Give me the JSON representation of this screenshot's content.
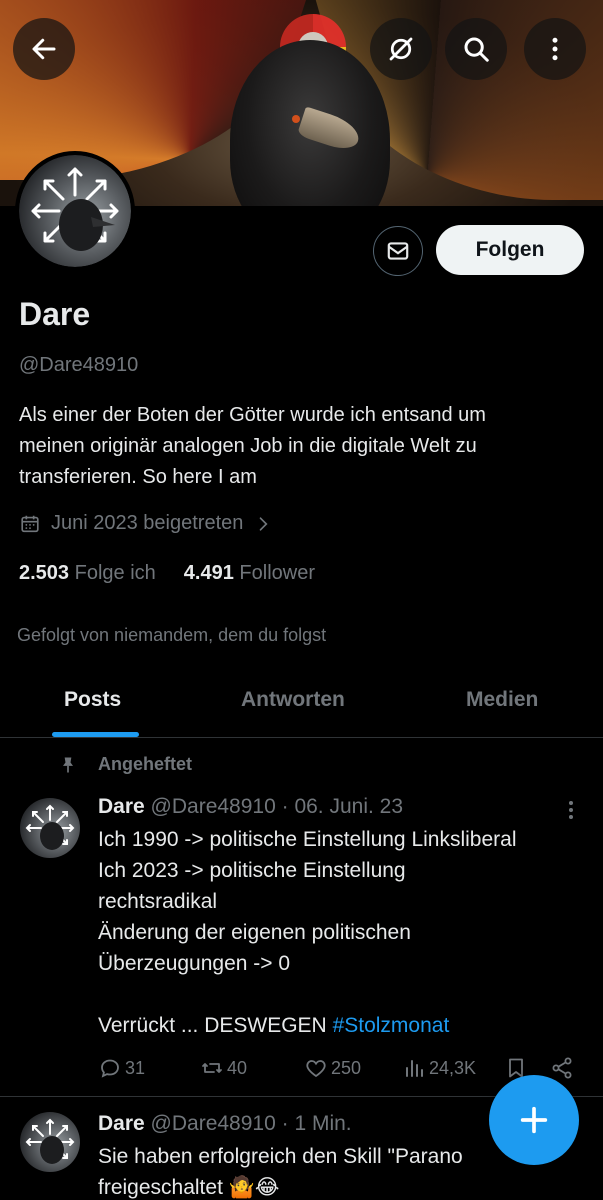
{
  "profile": {
    "name": "Dare",
    "handle": "@Dare48910",
    "bio_lines": [
      "Als einer der Boten der Götter wurde ich entsand um",
      "meinen originär analogen Job in die digitale Welt zu",
      "transferieren.  So here I am"
    ],
    "joined": "Juni 2023 beigetreten",
    "following_count": "2.503",
    "following_label": "Folge ich",
    "followers_count": "4.491",
    "followers_label": "Follower",
    "followed_by": "Gefolgt von niemandem, dem du folgst",
    "follow_button": "Folgen"
  },
  "tabs": [
    {
      "label": "Posts",
      "active": true
    },
    {
      "label": "Antworten",
      "active": false
    },
    {
      "label": "Medien",
      "active": false
    }
  ],
  "pinned_label": "Angeheftet",
  "posts": [
    {
      "name": "Dare",
      "handle": "@Dare48910",
      "time": "· 06. Juni. 23",
      "lines": [
        "Ich 1990 -> politische Einstellung Linksliberal",
        "Ich 2023 -> politische Einstellung",
        "rechtsradikal",
        "Änderung der eigenen politischen",
        "Überzeugungen -> 0",
        "",
        "Verrückt ... DESWEGEN "
      ],
      "hashtag": "#Stolzmonat",
      "replies": "31",
      "reposts": "40",
      "likes": "250",
      "views": "24,3K"
    },
    {
      "name": "Dare",
      "handle": "@Dare48910",
      "time": "· 1 Min.",
      "lines": [
        "Sie haben erfolgreich den Skill \"Parano",
        "freigeschaltet 🤷😂"
      ]
    }
  ],
  "colors": {
    "accent": "#1d9bf0",
    "text": "#e7e9ea",
    "muted": "#71767b",
    "background": "#000000"
  },
  "icons": [
    "back-arrow-icon",
    "no-notify-icon",
    "search-icon",
    "more-vertical-icon",
    "mail-icon",
    "calendar-icon",
    "chevron-right-icon",
    "pin-icon",
    "reply-icon",
    "repost-icon",
    "like-icon",
    "views-icon",
    "bookmark-icon",
    "share-icon",
    "plus-icon"
  ]
}
